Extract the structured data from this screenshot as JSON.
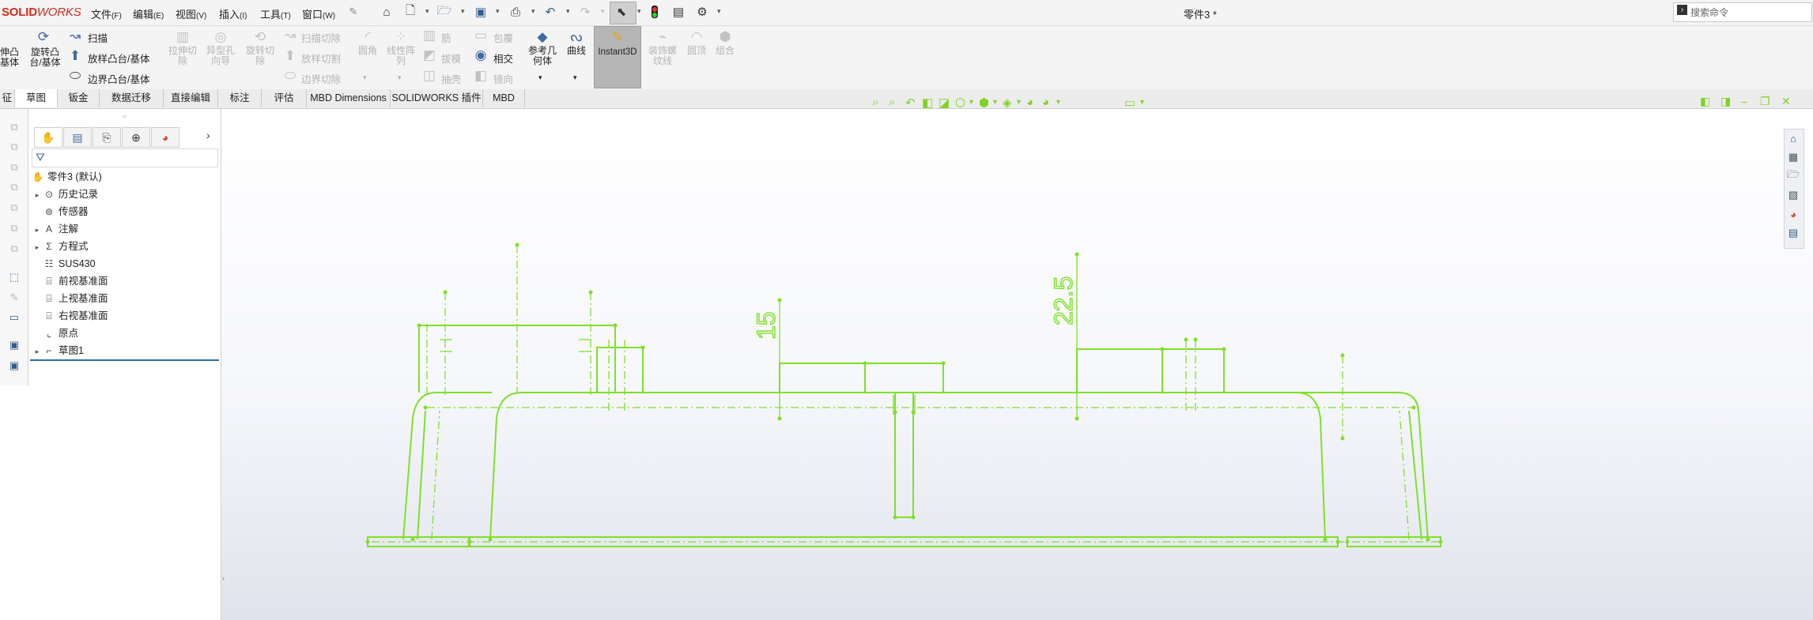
{
  "app": {
    "logo_part1": "SOLID",
    "logo_part2": "WORKS",
    "document_title": "零件3 *"
  },
  "menu": [
    {
      "label": "文件",
      "key": "(F)"
    },
    {
      "label": "编辑",
      "key": "(E)"
    },
    {
      "label": "视图",
      "key": "(V)"
    },
    {
      "label": "插入",
      "key": "(I)"
    },
    {
      "label": "工具",
      "key": "(T)"
    },
    {
      "label": "窗口",
      "key": "(W)"
    }
  ],
  "search": {
    "placeholder": "搜索命令"
  },
  "ribbon": {
    "extrude_boss": "伸凸\n基体",
    "revolve_boss": "旋转凸\n台/基体",
    "sweep": "扫描",
    "loft_boss": "放样凸台/基体",
    "boundary_boss": "边界凸台/基体",
    "extrude_cut": "拉伸切\n除",
    "hole_wizard": "异型孔\n向导",
    "revolve_cut": "旋转切\n除",
    "swept_cut": "扫描切除",
    "lofted_cut": "放样切割",
    "boundary_cut": "边界切除",
    "fillet": "圆角",
    "linear_pattern": "线性阵\n列",
    "rib": "筋",
    "draft": "拔模",
    "shell": "抽壳",
    "wrap": "包覆",
    "intersect": "相交",
    "mirror": "镜向",
    "reference_geometry": "参考几\n何体",
    "curves": "曲线",
    "instant3d": "Instant3D",
    "cosmetic_thread": "装饰螺\n纹线",
    "dome": "圆顶",
    "combine": "组合"
  },
  "tabs": [
    "征",
    "草图",
    "钣金",
    "数据迁移",
    "直接编辑",
    "标注",
    "评估",
    "MBD Dimensions",
    "SOLIDWORKS 插件",
    "MBD"
  ],
  "tree": {
    "root": "零件3 (默认)",
    "items": [
      {
        "label": "历史记录",
        "icon": "history-icon",
        "expandable": true
      },
      {
        "label": "传感器",
        "icon": "sensor-icon",
        "expandable": false
      },
      {
        "label": "注解",
        "icon": "annotation-icon",
        "expandable": true
      },
      {
        "label": "方程式",
        "icon": "equation-icon",
        "expandable": true
      },
      {
        "label": "SUS430",
        "icon": "material-icon",
        "expandable": false
      },
      {
        "label": "前视基准面",
        "icon": "plane-icon",
        "expandable": false
      },
      {
        "label": "上视基准面",
        "icon": "plane-icon",
        "expandable": false
      },
      {
        "label": "右视基准面",
        "icon": "plane-icon",
        "expandable": false
      },
      {
        "label": "原点",
        "icon": "origin-icon",
        "expandable": false
      },
      {
        "label": "草图1",
        "icon": "sketch-icon",
        "expandable": true
      }
    ]
  },
  "sketch": {
    "dimension_1": "15",
    "dimension_2": "22.5",
    "color": "#7fe02a"
  }
}
